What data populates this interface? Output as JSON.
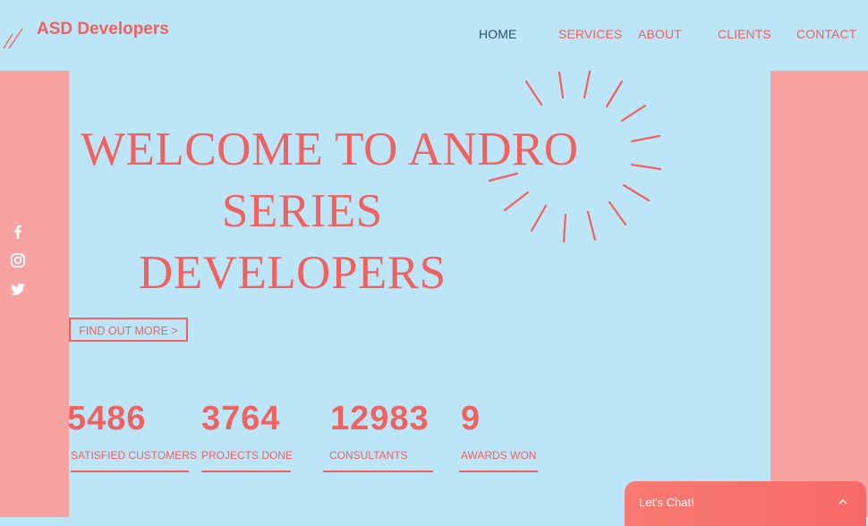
{
  "header": {
    "logo_text": "ASD Developers",
    "nav": {
      "home": "HOME",
      "services": "SERVICES",
      "about": "ABOUT",
      "clients": "CLIENTS",
      "contact": "CONTACT"
    }
  },
  "social": {
    "icons": [
      "facebook-icon",
      "instagram-icon",
      "twitter-icon"
    ]
  },
  "hero": {
    "title_line1": "WELCOME TO ANDRO",
    "title_line2": "SERIES",
    "title_line3": "DEVELOPERS",
    "cta_label": "FIND OUT MORE >"
  },
  "stats": [
    {
      "value": "5486",
      "label": "SATISFIED CUSTOMERS"
    },
    {
      "value": "3764",
      "label": "PROJECTS DONE"
    },
    {
      "value": "12983",
      "label": "CONSULTANTS"
    },
    {
      "value": "9",
      "label": "AWARDS WON"
    }
  ],
  "chat": {
    "label": "Let's Chat!"
  },
  "colors": {
    "background": "#bde5f8",
    "accent": "#f0625f",
    "side_panels": "#f8a3a2",
    "nav_active": "#2e4f6a",
    "chat": "#f86a66"
  }
}
